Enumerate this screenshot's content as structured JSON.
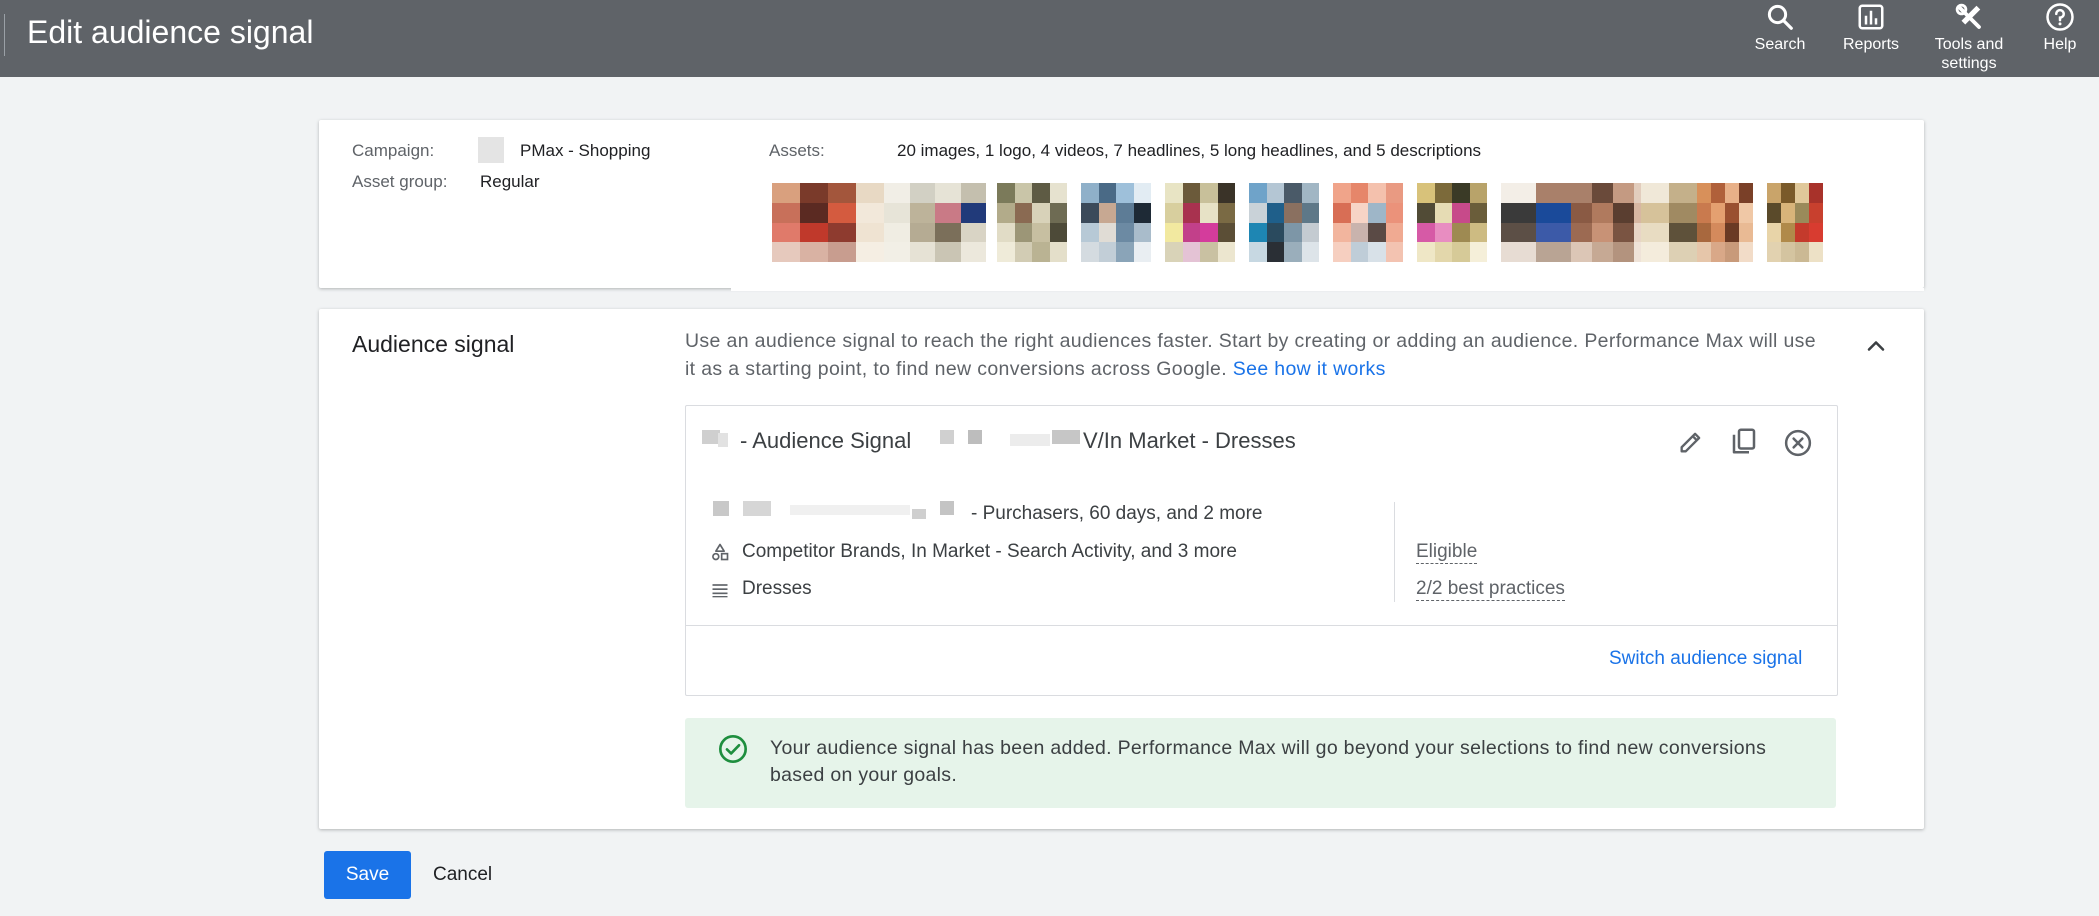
{
  "header": {
    "title": "Edit audience signal",
    "nav": [
      {
        "label": "Search",
        "icon": "search-icon"
      },
      {
        "label": "Reports",
        "icon": "reports-icon"
      },
      {
        "label": "Tools and settings",
        "icon": "tools-icon"
      },
      {
        "label": "Help",
        "icon": "help-icon"
      }
    ]
  },
  "summary": {
    "campaign_label": "Campaign:",
    "campaign_value": "PMax - Shopping",
    "asset_group_label": "Asset group:",
    "asset_group_value": "Regular",
    "assets_label": "Assets:",
    "assets_value": "20 images, 1 logo, 4 videos, 7 headlines, 5 long headlines, and 5 descriptions"
  },
  "audience": {
    "title": "Audience signal",
    "description": "Use an audience signal to reach the right audiences faster. Start by creating or adding an audience. Performance Max will use it as a starting point, to find new conversions across Google.",
    "learn_link": "See how it works",
    "signal": {
      "name_part1": "- Audience Signal",
      "name_part2": "V/In Market - Dresses",
      "items": [
        {
          "icon": "person-icon",
          "text": "- Purchasers, 60 days, and 2 more"
        },
        {
          "icon": "shapes-icon",
          "text": "Competitor Brands, In Market - Search Activity, and 3 more"
        },
        {
          "icon": "list-icon",
          "text": "Dresses"
        }
      ],
      "status": "Eligible",
      "best_practices": "2/2 best practices",
      "switch_link": "Switch audience signal"
    },
    "banner": "Your audience signal has been added. Performance Max will go beyond your selections to find new conversions based on your goals."
  },
  "actions": {
    "save": "Save",
    "cancel": "Cancel"
  },
  "colors": {
    "topbar": "#5f6368",
    "primary": "#1a73e8",
    "success_bg": "#e6f4ea",
    "success_icon": "#1e8e3e"
  }
}
